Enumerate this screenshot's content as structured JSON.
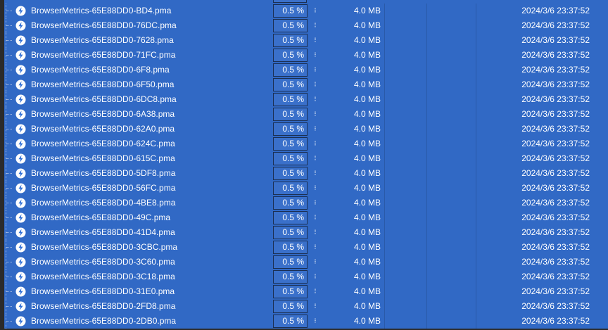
{
  "colors": {
    "selection": "#3169c5",
    "background": "#2b2b2b",
    "percent_box": "#3a70ca",
    "icon_circle": "#ffffff",
    "icon_glyph": "#2f6fd6"
  },
  "rows": [
    {
      "name": "BrowserMetrics-65E88DD0-BD4.pma",
      "percent": "0.5 %",
      "grip": "⁝",
      "size": "4.0 MB",
      "modified": "2024/3/6 23:37:52",
      "icon": "bolt-file-icon"
    },
    {
      "name": "BrowserMetrics-65E88DD0-76DC.pma",
      "percent": "0.5 %",
      "grip": "⁝",
      "size": "4.0 MB",
      "modified": "2024/3/6 23:37:52",
      "icon": "bolt-file-icon"
    },
    {
      "name": "BrowserMetrics-65E88DD0-7628.pma",
      "percent": "0.5 %",
      "grip": "⁝",
      "size": "4.0 MB",
      "modified": "2024/3/6 23:37:52",
      "icon": "bolt-file-icon"
    },
    {
      "name": "BrowserMetrics-65E88DD0-71FC.pma",
      "percent": "0.5 %",
      "grip": "⁝",
      "size": "4.0 MB",
      "modified": "2024/3/6 23:37:52",
      "icon": "bolt-file-icon"
    },
    {
      "name": "BrowserMetrics-65E88DD0-6F8.pma",
      "percent": "0.5 %",
      "grip": "⁝",
      "size": "4.0 MB",
      "modified": "2024/3/6 23:37:52",
      "icon": "bolt-file-icon"
    },
    {
      "name": "BrowserMetrics-65E88DD0-6F50.pma",
      "percent": "0.5 %",
      "grip": "⁝",
      "size": "4.0 MB",
      "modified": "2024/3/6 23:37:52",
      "icon": "bolt-file-icon"
    },
    {
      "name": "BrowserMetrics-65E88DD0-6DC8.pma",
      "percent": "0.5 %",
      "grip": "⁝",
      "size": "4.0 MB",
      "modified": "2024/3/6 23:37:52",
      "icon": "bolt-file-icon"
    },
    {
      "name": "BrowserMetrics-65E88DD0-6A38.pma",
      "percent": "0.5 %",
      "grip": "⁝",
      "size": "4.0 MB",
      "modified": "2024/3/6 23:37:52",
      "icon": "bolt-file-icon"
    },
    {
      "name": "BrowserMetrics-65E88DD0-62A0.pma",
      "percent": "0.5 %",
      "grip": "⁝",
      "size": "4.0 MB",
      "modified": "2024/3/6 23:37:52",
      "icon": "bolt-file-icon"
    },
    {
      "name": "BrowserMetrics-65E88DD0-624C.pma",
      "percent": "0.5 %",
      "grip": "⁝",
      "size": "4.0 MB",
      "modified": "2024/3/6 23:37:52",
      "icon": "bolt-file-icon"
    },
    {
      "name": "BrowserMetrics-65E88DD0-615C.pma",
      "percent": "0.5 %",
      "grip": "⁝",
      "size": "4.0 MB",
      "modified": "2024/3/6 23:37:52",
      "icon": "bolt-file-icon"
    },
    {
      "name": "BrowserMetrics-65E88DD0-5DF8.pma",
      "percent": "0.5 %",
      "grip": "⁝",
      "size": "4.0 MB",
      "modified": "2024/3/6 23:37:52",
      "icon": "bolt-file-icon"
    },
    {
      "name": "BrowserMetrics-65E88DD0-56FC.pma",
      "percent": "0.5 %",
      "grip": "⁝",
      "size": "4.0 MB",
      "modified": "2024/3/6 23:37:52",
      "icon": "bolt-file-icon"
    },
    {
      "name": "BrowserMetrics-65E88DD0-4BE8.pma",
      "percent": "0.5 %",
      "grip": "⁝",
      "size": "4.0 MB",
      "modified": "2024/3/6 23:37:52",
      "icon": "bolt-file-icon"
    },
    {
      "name": "BrowserMetrics-65E88DD0-49C.pma",
      "percent": "0.5 %",
      "grip": "⁝",
      "size": "4.0 MB",
      "modified": "2024/3/6 23:37:52",
      "icon": "bolt-file-icon"
    },
    {
      "name": "BrowserMetrics-65E88DD0-41D4.pma",
      "percent": "0.5 %",
      "grip": "⁝",
      "size": "4.0 MB",
      "modified": "2024/3/6 23:37:52",
      "icon": "bolt-file-icon"
    },
    {
      "name": "BrowserMetrics-65E88DD0-3CBC.pma",
      "percent": "0.5 %",
      "grip": "⁝",
      "size": "4.0 MB",
      "modified": "2024/3/6 23:37:52",
      "icon": "bolt-file-icon"
    },
    {
      "name": "BrowserMetrics-65E88DD0-3C60.pma",
      "percent": "0.5 %",
      "grip": "⁝",
      "size": "4.0 MB",
      "modified": "2024/3/6 23:37:52",
      "icon": "bolt-file-icon"
    },
    {
      "name": "BrowserMetrics-65E88DD0-3C18.pma",
      "percent": "0.5 %",
      "grip": "⁝",
      "size": "4.0 MB",
      "modified": "2024/3/6 23:37:52",
      "icon": "bolt-file-icon"
    },
    {
      "name": "BrowserMetrics-65E88DD0-31E0.pma",
      "percent": "0.5 %",
      "grip": "⁝",
      "size": "4.0 MB",
      "modified": "2024/3/6 23:37:52",
      "icon": "bolt-file-icon"
    },
    {
      "name": "BrowserMetrics-65E88DD0-2FD8.pma",
      "percent": "0.5 %",
      "grip": "⁝",
      "size": "4.0 MB",
      "modified": "2024/3/6 23:37:52",
      "icon": "bolt-file-icon"
    },
    {
      "name": "BrowserMetrics-65E88DD0-2DB0.pma",
      "percent": "0.5 %",
      "grip": "⁝",
      "size": "4.0 MB",
      "modified": "2024/3/6 23:37:52",
      "icon": "bolt-file-icon"
    }
  ]
}
